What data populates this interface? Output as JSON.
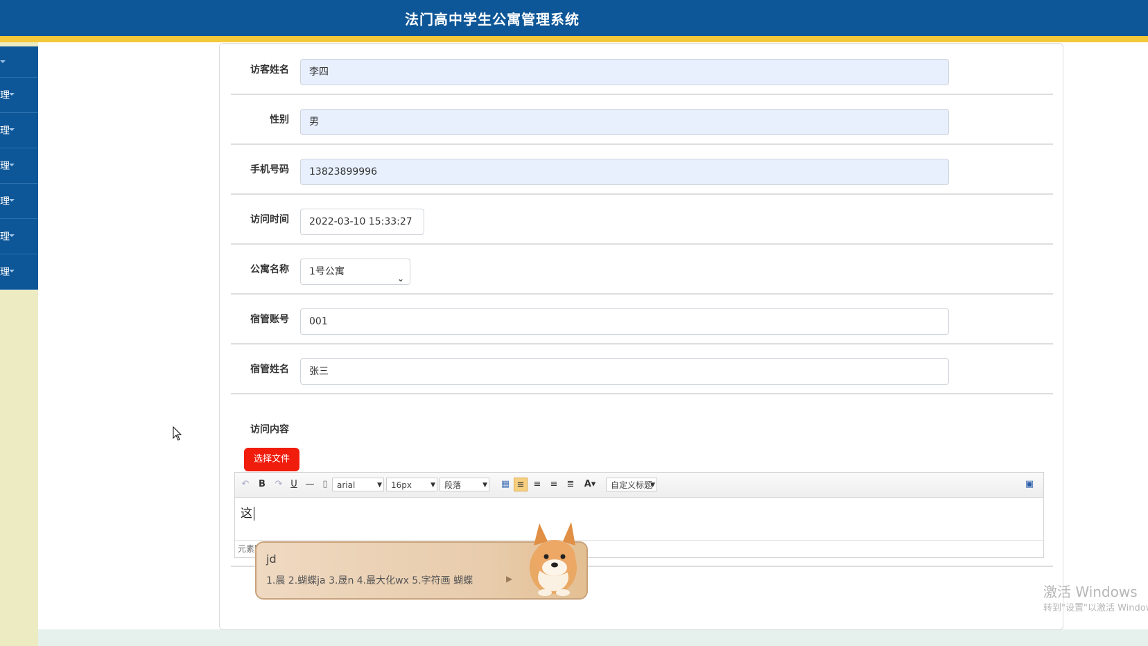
{
  "header": {
    "title": "法门高中学生公寓管理系统"
  },
  "sidebar": {
    "items": [
      {
        "label": ""
      },
      {
        "label": "理"
      },
      {
        "label": "理"
      },
      {
        "label": "理"
      },
      {
        "label": "理"
      },
      {
        "label": "理"
      },
      {
        "label": "理"
      }
    ]
  },
  "form": {
    "visitor_name": {
      "label": "访客姓名",
      "value": "李四"
    },
    "gender": {
      "label": "性别",
      "value": "男"
    },
    "phone": {
      "label": "手机号码",
      "value": "13823899996"
    },
    "visit_time": {
      "label": "访问时间",
      "value": "2022-03-10 15:33:27"
    },
    "apartment": {
      "label": "公寓名称",
      "value": "1号公寓"
    },
    "manager_account": {
      "label": "宿管账号",
      "value": "001"
    },
    "manager_name": {
      "label": "宿管姓名",
      "value": "张三"
    },
    "content_label": "访问内容",
    "choose_file": "选择文件"
  },
  "editor": {
    "font": "arial",
    "size": "16px",
    "paragraph": "段落",
    "custom_title": "自定义标题",
    "body_text": "这",
    "footer_text": "元素路"
  },
  "ime": {
    "input": "jd",
    "candidates": "1.晨  2.蝴蝶ja  3.晟n  4.最大化wx  5.字符画 蝴蝶"
  },
  "watermark": {
    "line1": "激活 Windows",
    "line2": "转到\"设置\"以激活 Windows。"
  },
  "colors": {
    "header": "#0d5697",
    "stripe": "#f3c83a",
    "accent_red": "#f01d0d",
    "autofill": "#e8f0fe"
  }
}
